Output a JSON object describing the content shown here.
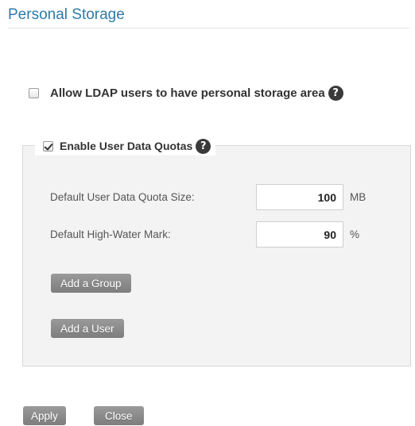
{
  "page": {
    "title": "Personal Storage"
  },
  "ldap": {
    "checked": false,
    "label": "Allow LDAP users to have personal storage area",
    "help_icon": "question-circle-icon"
  },
  "quotas": {
    "checked": true,
    "legend_label": "Enable User Data Quotas",
    "help_icon": "question-circle-icon",
    "fields": [
      {
        "label": "Default User Data Quota Size:",
        "value": "100",
        "unit": "MB"
      },
      {
        "label": "Default High-Water Mark:",
        "value": "90",
        "unit": "%"
      }
    ],
    "add_group_label": "Add a Group",
    "add_user_label": "Add a User"
  },
  "footer": {
    "apply_label": "Apply",
    "close_label": "Close"
  },
  "colors": {
    "title": "#2e7aa8",
    "button": "#8a8a8a",
    "panel": "#f3f3f3"
  }
}
